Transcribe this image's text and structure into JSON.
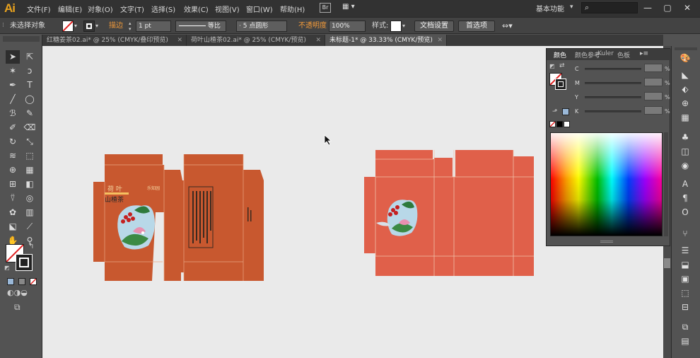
{
  "app": {
    "logo": "Ai"
  },
  "menu": [
    "文件(F)",
    "编辑(E)",
    "对象(O)",
    "文字(T)",
    "选择(S)",
    "效果(C)",
    "视图(V)",
    "窗口(W)",
    "帮助(H)"
  ],
  "menubar": {
    "bridge_label": "Br",
    "workspace": "基本功能",
    "search_placeholder": ""
  },
  "controlbar": {
    "selection": "未选择对象",
    "stroke_label": "描边",
    "stroke_weight": "1 pt",
    "stroke_profile": "等比",
    "brush": "5 点圆形",
    "opacity_label": "不透明度",
    "opacity": "100%",
    "style_label": "样式:",
    "doc_setup": "文档设置",
    "preferences": "首选项"
  },
  "tabs": [
    {
      "label": "红糖姜茶02.ai* @ 25% (CMYK/叠印预览)",
      "active": false
    },
    {
      "label": "荷叶山楂茶02.ai* @ 25% (CMYK/预览)",
      "active": false
    },
    {
      "label": "未标题-1* @ 33.33% (CMYK/预览)",
      "active": true
    }
  ],
  "artwork": {
    "box1": {
      "title_line1": "荷 叶",
      "title_line2": "山楂茶",
      "brand": "乐知园"
    },
    "colors": {
      "box_dark": "#c8582f",
      "box_light": "#e0604a",
      "fold_line": "#f0c0a8"
    }
  },
  "colorpanel": {
    "tabs": [
      "颜色",
      "颜色参考",
      "Kuler",
      "色板"
    ],
    "channels": [
      {
        "name": "C",
        "unit": "%"
      },
      {
        "name": "M",
        "unit": "%"
      },
      {
        "name": "Y",
        "unit": "%"
      },
      {
        "name": "K",
        "unit": "%"
      }
    ]
  },
  "tools": {
    "icons": [
      "selection-tool",
      "direct-selection-tool",
      "magic-wand-tool",
      "lasso-tool",
      "pen-tool",
      "type-tool",
      "line-tool",
      "ellipse-tool",
      "paintbrush-tool",
      "pencil-tool",
      "blob-brush-tool",
      "eraser-tool",
      "rotate-tool",
      "scale-tool",
      "width-tool",
      "free-transform-tool",
      "shape-builder-tool",
      "perspective-tool",
      "mesh-tool",
      "gradient-tool",
      "eyedropper-tool",
      "blend-tool",
      "symbol-sprayer-tool",
      "graph-tool",
      "artboard-tool",
      "slice-tool",
      "hand-tool",
      "zoom-tool"
    ]
  }
}
